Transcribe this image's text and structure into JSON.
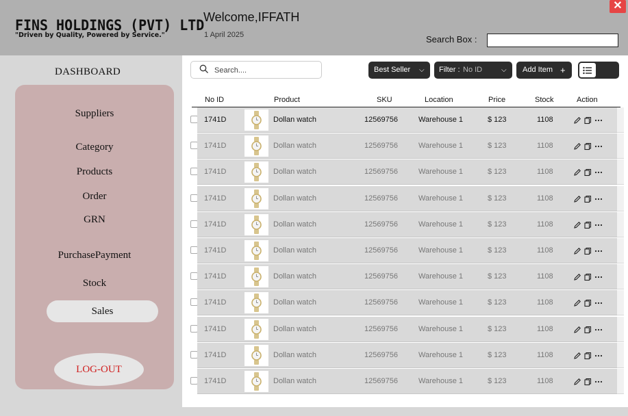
{
  "header": {
    "company": "FINS HOLDINGS (PVT) LTD",
    "tagline": "\"Driven by Quality, Powered by Service.\"",
    "welcome": "Welcome,IFFATH",
    "date": "1 April 2025",
    "search_label": "Search Box :",
    "close_label": "✕"
  },
  "sidebar": {
    "title": "DASHBOARD",
    "items": [
      {
        "label": "Suppliers"
      },
      {
        "label": "Category"
      },
      {
        "label": "Products"
      },
      {
        "label": "Order"
      },
      {
        "label": "GRN"
      },
      {
        "label": "PurchasePayment"
      },
      {
        "label": "Stock"
      },
      {
        "label": "Sales"
      }
    ],
    "active": "Sales",
    "logout_label": "LOG-OUT"
  },
  "toolbar": {
    "search_placeholder": "Search....",
    "sort_label": "Best Seller",
    "filter_label": "Filter :",
    "filter_value": "No ID",
    "add_label": "Add Item",
    "add_icon": "+"
  },
  "table": {
    "columns": [
      "No ID",
      "Product",
      "SKU",
      "Location",
      "Price",
      "Stock",
      "Action"
    ],
    "rows": [
      {
        "id": "1741D",
        "product": "Dollan watch",
        "sku": "12569756",
        "location": "Warehouse 1",
        "price": "$ 123",
        "stock": "1108"
      },
      {
        "id": "1741D",
        "product": "Dollan watch",
        "sku": "12569756",
        "location": "Warehouse 1",
        "price": "$ 123",
        "stock": "1108"
      },
      {
        "id": "1741D",
        "product": "Dollan watch",
        "sku": "12569756",
        "location": "Warehouse 1",
        "price": "$ 123",
        "stock": "1108"
      },
      {
        "id": "1741D",
        "product": "Dollan watch",
        "sku": "12569756",
        "location": "Warehouse 1",
        "price": "$ 123",
        "stock": "1108"
      },
      {
        "id": "1741D",
        "product": "Dollan watch",
        "sku": "12569756",
        "location": "Warehouse 1",
        "price": "$ 123",
        "stock": "1108"
      },
      {
        "id": "1741D",
        "product": "Dollan watch",
        "sku": "12569756",
        "location": "Warehouse 1",
        "price": "$ 123",
        "stock": "1108"
      },
      {
        "id": "1741D",
        "product": "Dollan watch",
        "sku": "12569756",
        "location": "Warehouse 1",
        "price": "$ 123",
        "stock": "1108"
      },
      {
        "id": "1741D",
        "product": "Dollan watch",
        "sku": "12569756",
        "location": "Warehouse 1",
        "price": "$ 123",
        "stock": "1108"
      },
      {
        "id": "1741D",
        "product": "Dollan watch",
        "sku": "12569756",
        "location": "Warehouse 1",
        "price": "$ 123",
        "stock": "1108"
      },
      {
        "id": "1741D",
        "product": "Dollan watch",
        "sku": "12569756",
        "location": "Warehouse 1",
        "price": "$ 123",
        "stock": "1108"
      },
      {
        "id": "1741D",
        "product": "Dollan watch",
        "sku": "12569756",
        "location": "Warehouse 1",
        "price": "$ 123",
        "stock": "1108"
      }
    ],
    "row_icons": [
      "watch-icon",
      "edit-icon",
      "copy-icon",
      "more-icon"
    ]
  },
  "colors": {
    "header_bg": "#b0b0b0",
    "sidebar_bg": "#c9aeae",
    "close_bg": "#e64545",
    "logout_text": "#d02020",
    "button_bg": "#2c2c2c"
  }
}
